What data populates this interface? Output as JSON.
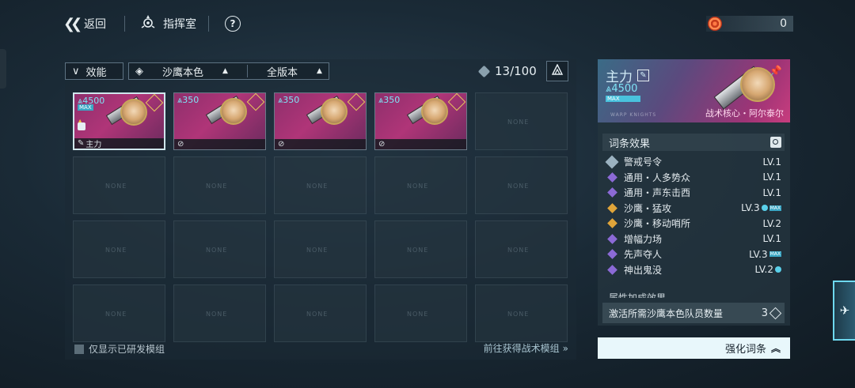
{
  "topbar": {
    "back_label": "返回",
    "command_label": "指挥室",
    "help_label": "?",
    "currency_value": "0"
  },
  "filters": {
    "function_label": "效能",
    "faction_label": "沙鹰本色",
    "version_label": "全版本",
    "collection_count": "13/100"
  },
  "cards": [
    {
      "power": "4500",
      "max": "MAX",
      "footer": "主力",
      "selected": true
    },
    {
      "power": "350",
      "footer": ""
    },
    {
      "power": "350",
      "footer": ""
    },
    {
      "power": "350",
      "footer": ""
    }
  ],
  "empty_slot_label": "NONE",
  "bottom": {
    "only_developed_label": "仅显示已研发模组",
    "go_get_label": "前往获得战术模组"
  },
  "detail": {
    "title": "主力",
    "power": "4500",
    "max": "MAX",
    "brand": "WARP KNIGHTS",
    "core_tag": "战术核心・阿尔泰尔",
    "effects_header": "词条效果",
    "effects": [
      {
        "name": "警戒号令",
        "level": "LV.1",
        "color": "silver"
      },
      {
        "name": "通用・人多势众",
        "level": "LV.1",
        "color": "purple"
      },
      {
        "name": "通用・声东击西",
        "level": "LV.1",
        "color": "purple"
      },
      {
        "name": "沙鹰・猛攻",
        "level": "LV.3",
        "color": "gold",
        "badge": "MAX",
        "up": true
      },
      {
        "name": "沙鹰・移动哨所",
        "level": "LV.2",
        "color": "gold"
      },
      {
        "name": "增幅力场",
        "level": "LV.1",
        "color": "purple"
      },
      {
        "name": "先声夺人",
        "level": "LV.3",
        "color": "purple",
        "badge": "MAX"
      },
      {
        "name": "神出鬼没",
        "level": "LV.2",
        "color": "purple",
        "up": true
      }
    ],
    "attr_header": "属性加成效果",
    "need_label": "激活所需沙鹰本色队员数量",
    "need_value": "3"
  },
  "enhance_label": "强化词条",
  "colors": {
    "accent": "#7ee3f5",
    "card_pink": "#b03578",
    "gold": "#e0a53a",
    "purple": "#8c6ad6"
  }
}
